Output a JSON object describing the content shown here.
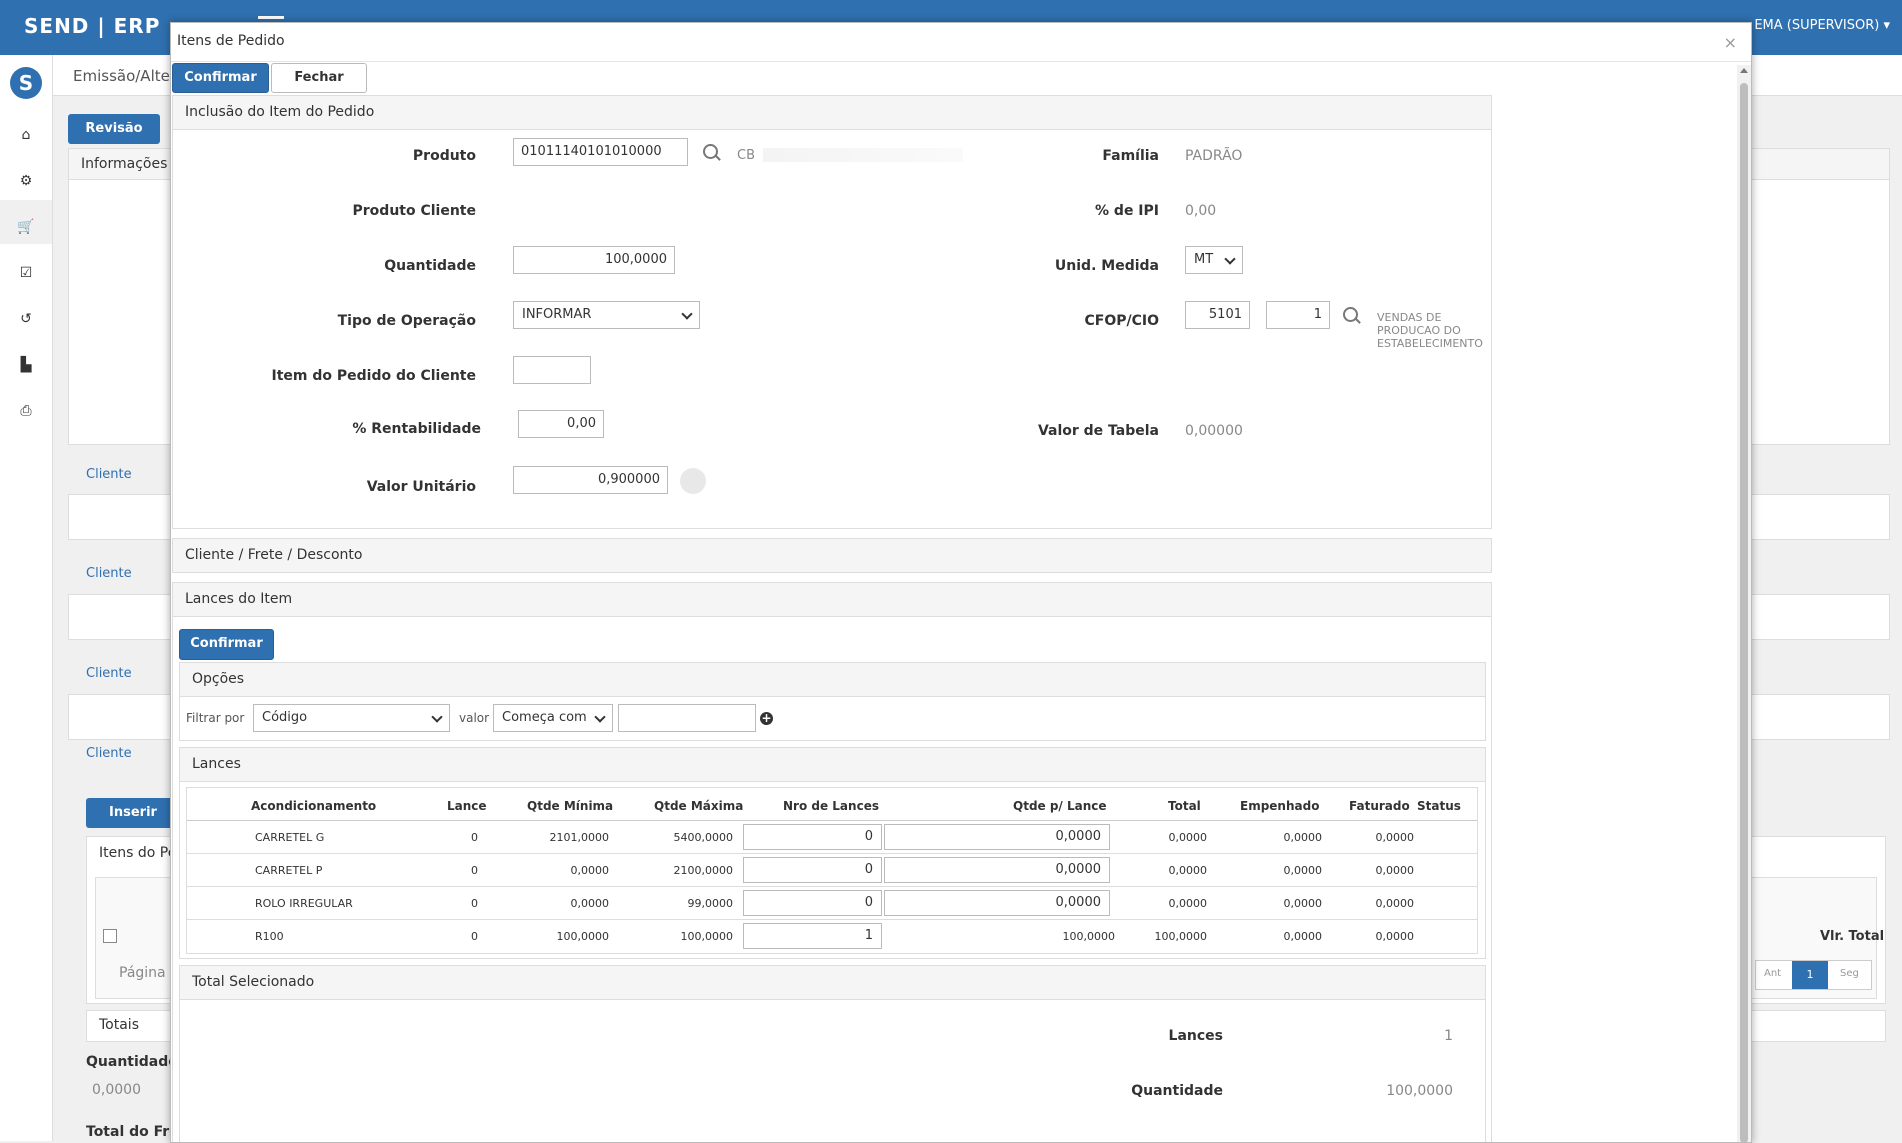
{
  "app": {
    "brand": "SEND | ERP",
    "user": "EMA (SUPERVISOR)",
    "breadcrumb": "Emissão/Alte",
    "revisao_label": "Revisão",
    "informacoes_label": "Informações",
    "inserir_label": "Inserir",
    "itens_do_pe_label": "Itens do Pe",
    "pagina_label": "Página",
    "totais_label": "Totais",
    "quantidade_label": "Quantidade",
    "quantidade_value": "0,0000",
    "total_do_fre_label": "Total do Fre",
    "vlr_total_label": "Vlr. Total",
    "pagination": {
      "prev": "Ant",
      "current": "1",
      "next": "Seg"
    },
    "cliente_links": [
      "Cliente",
      "Cliente",
      "Cliente",
      "Cliente"
    ],
    "sidebar_icons": [
      "home-icon",
      "cogs-icon",
      "cart-icon",
      "checklist-icon",
      "history-icon",
      "chart-icon",
      "print-icon"
    ]
  },
  "modal": {
    "title": "Itens de Pedido",
    "close": "×",
    "confirm_label": "Confirmar",
    "close_label": "Fechar",
    "inclusao": {
      "title": "Inclusão do Item do Pedido",
      "produto_label": "Produto",
      "produto_value": "01011140101010000",
      "produto_desc": "CB",
      "familia_label": "Família",
      "familia_value": "PADRÃO",
      "produto_cliente_label": "Produto Cliente",
      "ipi_label": "% de IPI",
      "ipi_value": "0,00",
      "quantidade_label": "Quantidade",
      "quantidade_value": "100,0000",
      "unid_medida_label": "Unid. Medida",
      "unid_medida_value": "MT",
      "tipo_operacao_label": "Tipo de Operação",
      "tipo_operacao_value": "INFORMAR",
      "cfop_label": "CFOP/CIO",
      "cfop_value": "5101",
      "cio_value": "1",
      "cfop_desc": "VENDAS DE PRODUCAO DO ESTABELECIMENTO",
      "item_pedido_cliente_label": "Item do Pedido do Cliente",
      "item_pedido_cliente_value": "",
      "rentabilidade_label": "% Rentabilidade",
      "rentabilidade_value": "0,00",
      "valor_tabela_label": "Valor de Tabela",
      "valor_tabela_value": "0,00000",
      "valor_unitario_label": "Valor Unitário",
      "valor_unitario_value": "0,900000"
    },
    "cliente_frete": {
      "title": "Cliente / Frete / Desconto"
    },
    "lances_item": {
      "title": "Lances do Item",
      "confirm_label": "Confirmar",
      "opcoes_title": "Opções",
      "filtrar_por_label": "Filtrar por",
      "filtrar_por_value": "Código",
      "valor_label": "valor",
      "comparador_value": "Começa com",
      "filtro_value": "",
      "lances_title": "Lances",
      "columns": [
        "Acondicionamento",
        "Lance",
        "Qtde Mínima",
        "Qtde Máxima",
        "Nro de Lances",
        "Qtde p/ Lance",
        "Total",
        "Empenhado",
        "Faturado",
        "Status"
      ],
      "rows": [
        {
          "acond": "CARRETEL G",
          "lance": "0",
          "min": "2101,0000",
          "max": "5400,0000",
          "nro": "0",
          "qtde": "0,0000",
          "total": "0,0000",
          "emp": "0,0000",
          "fat": "0,0000",
          "status": ""
        },
        {
          "acond": "CARRETEL P",
          "lance": "0",
          "min": "0,0000",
          "max": "2100,0000",
          "nro": "0",
          "qtde": "0,0000",
          "total": "0,0000",
          "emp": "0,0000",
          "fat": "0,0000",
          "status": ""
        },
        {
          "acond": "ROLO IRREGULAR",
          "lance": "0",
          "min": "0,0000",
          "max": "99,0000",
          "nro": "0",
          "qtde": "0,0000",
          "total": "0,0000",
          "emp": "0,0000",
          "fat": "0,0000",
          "status": ""
        },
        {
          "acond": "R100",
          "lance": "0",
          "min": "100,0000",
          "max": "100,0000",
          "nro": "1",
          "qtde": "100,0000",
          "total": "100,0000",
          "emp": "0,0000",
          "fat": "0,0000",
          "status": ""
        }
      ]
    },
    "total_selecionado": {
      "title": "Total Selecionado",
      "lances_label": "Lances",
      "lances_value": "1",
      "quantidade_label": "Quantidade",
      "quantidade_value": "100,0000"
    }
  }
}
